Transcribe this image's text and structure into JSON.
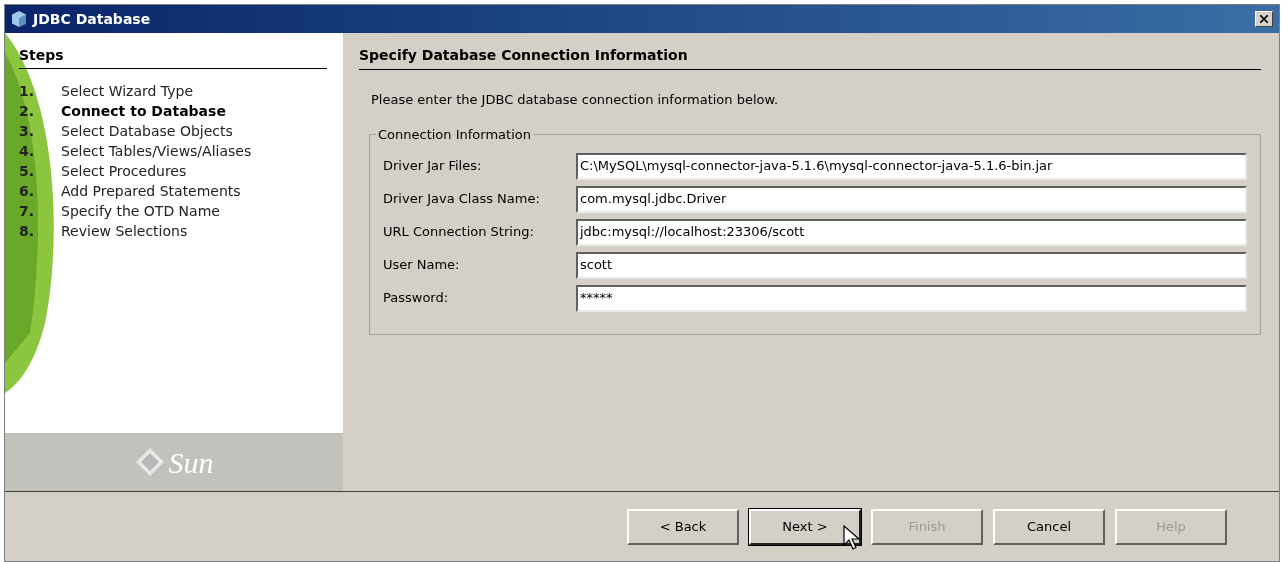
{
  "window": {
    "title": "JDBC Database"
  },
  "steps": {
    "title": "Steps",
    "items": [
      {
        "number": "1.",
        "label": "Select Wizard Type",
        "selected": false
      },
      {
        "number": "2.",
        "label": "Connect to Database",
        "selected": true
      },
      {
        "number": "3.",
        "label": "Select Database Objects",
        "selected": false
      },
      {
        "number": "4.",
        "label": "Select Tables/Views/Aliases",
        "selected": false
      },
      {
        "number": "5.",
        "label": "Select Procedures",
        "selected": false
      },
      {
        "number": "6.",
        "label": "Add Prepared Statements",
        "selected": false
      },
      {
        "number": "7.",
        "label": "Specify the OTD Name",
        "selected": false
      },
      {
        "number": "8.",
        "label": "Review Selections",
        "selected": false
      }
    ],
    "logo": "Sun"
  },
  "page": {
    "title": "Specify Database Connection Information",
    "intro": "Please enter the JDBC database connection information below.",
    "group": {
      "title": "Connection Information",
      "fields": [
        {
          "label": "Driver Jar Files:",
          "value": "C:\\MySQL\\mysql-connector-java-5.1.6\\mysql-connector-java-5.1.6-bin.jar"
        },
        {
          "label": "Driver Java Class Name:",
          "value": "com.mysql.jdbc.Driver"
        },
        {
          "label": "URL Connection String:",
          "value": "jdbc:mysql://localhost:23306/scott"
        },
        {
          "label": "User Name:",
          "value": "scott"
        },
        {
          "label": "Password:",
          "value": "*****"
        }
      ]
    }
  },
  "buttons": [
    {
      "label": "< Back",
      "disabled": false,
      "focused": false
    },
    {
      "label": "Next >",
      "disabled": false,
      "focused": true
    },
    {
      "label": "Finish",
      "disabled": true,
      "focused": false
    },
    {
      "label": "Cancel",
      "disabled": false,
      "focused": false
    },
    {
      "label": "Help",
      "disabled": true,
      "focused": false
    }
  ]
}
